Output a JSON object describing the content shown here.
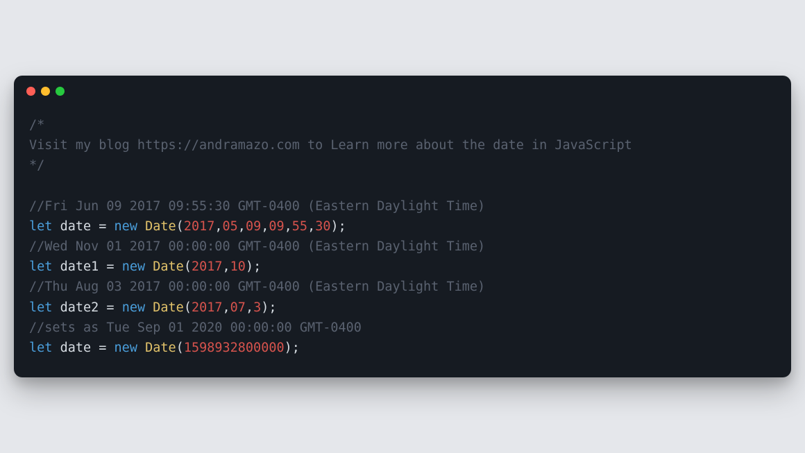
{
  "colors": {
    "bg": "#e5e7eb",
    "window": "#161b22",
    "comment": "#5a6270",
    "keyword": "#4a9edb",
    "variable": "#d7dde3",
    "class": "#e2c26a",
    "number": "#d6534d",
    "dot_red": "#ff5f56",
    "dot_yellow": "#ffbd2e",
    "dot_green": "#27c93f"
  },
  "titlebar": {
    "buttons": [
      "close",
      "minimize",
      "maximize"
    ]
  },
  "code": {
    "block_comment_open": "/*",
    "block_comment_text": "Visit my blog https://andramazo.com to Learn more about the date in JavaScript",
    "block_comment_close": "*/",
    "lines": [
      {
        "comment": "//Fri Jun 09 2017 09:55:30 GMT-0400 (Eastern Daylight Time)",
        "kw_let": "let",
        "var": "date",
        "eq": " = ",
        "kw_new": "new",
        "cls": "Date",
        "open": "(",
        "args": [
          "2017",
          "05",
          "09",
          "09",
          "55",
          "30"
        ],
        "close": ");"
      },
      {
        "comment": "//Wed Nov 01 2017 00:00:00 GMT-0400 (Eastern Daylight Time)",
        "kw_let": "let",
        "var": "date1",
        "eq": " = ",
        "kw_new": "new",
        "cls": "Date",
        "open": "(",
        "args": [
          "2017",
          "10"
        ],
        "close": ");"
      },
      {
        "comment": "//Thu Aug 03 2017 00:00:00 GMT-0400 (Eastern Daylight Time)",
        "kw_let": "let",
        "var": "date2",
        "eq": " = ",
        "kw_new": "new",
        "cls": "Date",
        "open": "(",
        "args": [
          "2017",
          "07",
          "3"
        ],
        "close": ");"
      },
      {
        "comment": "//sets as Tue Sep 01 2020 00:00:00 GMT-0400",
        "kw_let": "let",
        "var": "date",
        "eq": " = ",
        "kw_new": "new",
        "cls": "Date",
        "open": "(",
        "args": [
          "1598932800000"
        ],
        "close": ");"
      }
    ],
    "comma": ","
  }
}
